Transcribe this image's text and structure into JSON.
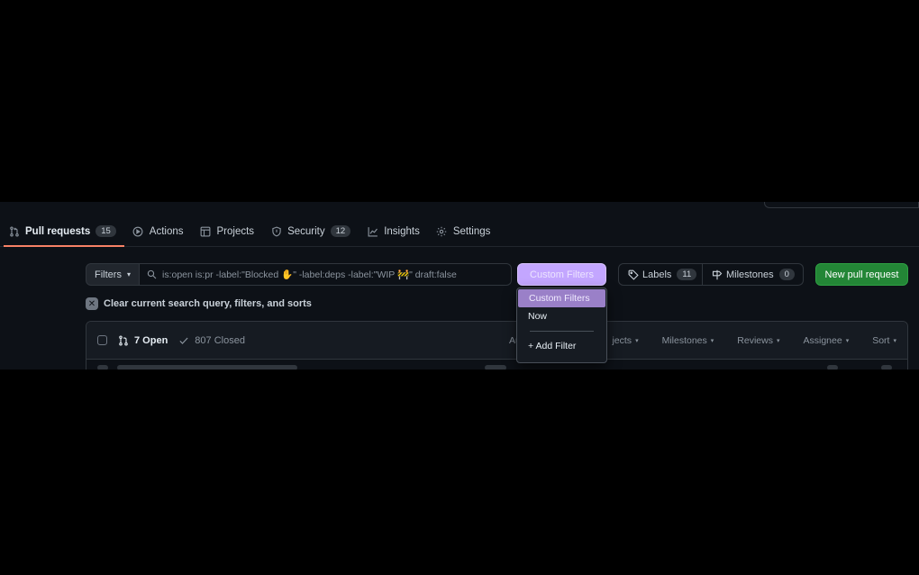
{
  "tabs": [
    {
      "label": "Pull requests",
      "count": "15",
      "icon": "git-pull-request-icon",
      "active": true
    },
    {
      "label": "Actions",
      "icon": "play-circle-icon"
    },
    {
      "label": "Projects",
      "icon": "table-icon"
    },
    {
      "label": "Security",
      "count": "12",
      "icon": "shield-icon"
    },
    {
      "label": "Insights",
      "icon": "graph-icon"
    },
    {
      "label": "Settings",
      "icon": "gear-icon"
    }
  ],
  "filters": {
    "button_label": "Filters",
    "search_value": "is:open is:pr -label:\"Blocked ✋\" -label:deps -label:\"WIP 🚧\" draft:false"
  },
  "custom_filters_button": "Custom Filters",
  "labels_button": {
    "label": "Labels",
    "count": "11"
  },
  "milestones_button": {
    "label": "Milestones",
    "count": "0"
  },
  "new_pr_button": "New pull request",
  "clear_query": "Clear current search query, filters, and sorts",
  "list_header": {
    "open": "7 Open",
    "closed": "807 Closed",
    "author": "Author",
    "projects": "jects",
    "milestones": "Milestones",
    "reviews": "Reviews",
    "assignee": "Assignee",
    "sort": "Sort"
  },
  "dropdown": {
    "items": [
      "Custom Filters",
      "Now"
    ],
    "add_filter": "+ Add Filter"
  },
  "colors": {
    "accent_purple": "#c3a6ff",
    "green": "#238636",
    "tab_underline": "#f78166"
  }
}
